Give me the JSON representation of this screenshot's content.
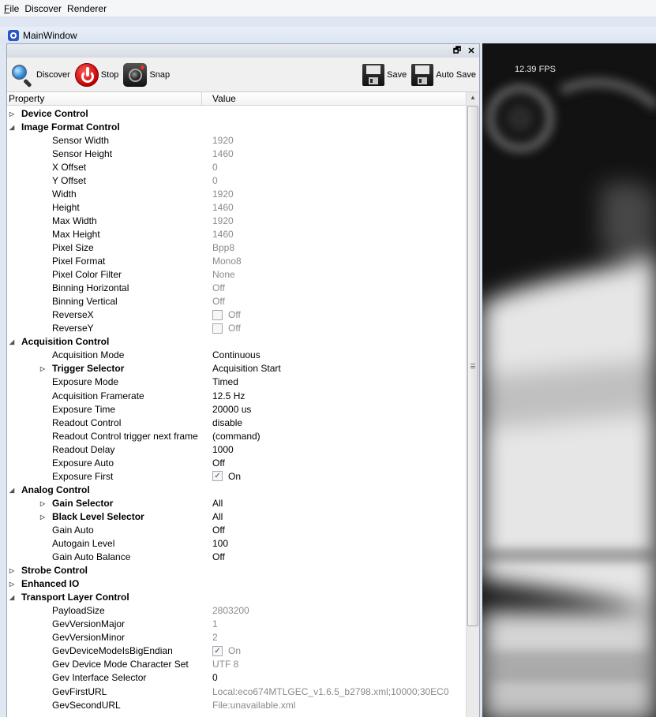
{
  "menu": {
    "items": [
      {
        "label": "File",
        "accel": "F",
        "rest": "ile"
      },
      {
        "label": "Discover",
        "accel": "",
        "rest": "Discover"
      },
      {
        "label": "Renderer",
        "accel": "",
        "rest": "Renderer"
      }
    ]
  },
  "window": {
    "title": "MainWindow"
  },
  "dock": {
    "float_glyph": "🗗",
    "close_glyph": "✕"
  },
  "toolbar": {
    "discover": "Discover",
    "stop": "Stop",
    "snap": "Snap",
    "save": "Save",
    "auto_save": "Auto Save"
  },
  "grid": {
    "header_property": "Property",
    "header_value": "Value",
    "rows": [
      {
        "name": "Device Control",
        "value": "",
        "level": 0,
        "expander": "collapsed",
        "ro": false
      },
      {
        "name": "Image Format Control",
        "value": "",
        "level": 0,
        "expander": "expanded",
        "ro": false
      },
      {
        "name": "Sensor Width",
        "value": "1920",
        "level": 1,
        "ro": true
      },
      {
        "name": "Sensor Height",
        "value": "1460",
        "level": 1,
        "ro": true
      },
      {
        "name": "X Offset",
        "value": "0",
        "level": 1,
        "ro": true
      },
      {
        "name": "Y Offset",
        "value": "0",
        "level": 1,
        "ro": true
      },
      {
        "name": "Width",
        "value": "1920",
        "level": 1,
        "ro": true
      },
      {
        "name": "Height",
        "value": "1460",
        "level": 1,
        "ro": true
      },
      {
        "name": "Max Width",
        "value": "1920",
        "level": 1,
        "ro": true
      },
      {
        "name": "Max Height",
        "value": "1460",
        "level": 1,
        "ro": true
      },
      {
        "name": "Pixel Size",
        "value": "Bpp8",
        "level": 1,
        "ro": true
      },
      {
        "name": "Pixel Format",
        "value": "Mono8",
        "level": 1,
        "ro": true
      },
      {
        "name": "Pixel Color Filter",
        "value": "None",
        "level": 1,
        "ro": true
      },
      {
        "name": "Binning Horizontal",
        "value": "Off",
        "level": 1,
        "ro": true
      },
      {
        "name": "Binning Vertical",
        "value": "Off",
        "level": 1,
        "ro": true
      },
      {
        "name": "ReverseX",
        "value": "Off",
        "level": 1,
        "ro": true,
        "checkbox": "unchecked"
      },
      {
        "name": "ReverseY",
        "value": "Off",
        "level": 1,
        "ro": true,
        "checkbox": "unchecked"
      },
      {
        "name": "Acquisition Control",
        "value": "",
        "level": 0,
        "expander": "expanded",
        "ro": false
      },
      {
        "name": "Acquisition Mode",
        "value": "Continuous",
        "level": 1,
        "ro": false
      },
      {
        "name": "Trigger Selector",
        "value": "Acquisition Start",
        "level": 1,
        "ro": false,
        "expander": "collapsed",
        "bold": true
      },
      {
        "name": "Exposure Mode",
        "value": "Timed",
        "level": 1,
        "ro": false
      },
      {
        "name": "Acquisition Framerate",
        "value": "12.5 Hz",
        "level": 1,
        "ro": false
      },
      {
        "name": "Exposure Time",
        "value": "20000 us",
        "level": 1,
        "ro": false
      },
      {
        "name": "Readout Control",
        "value": "disable",
        "level": 1,
        "ro": false
      },
      {
        "name": "Readout Control trigger next frame",
        "value": "(command)",
        "level": 1,
        "ro": false
      },
      {
        "name": "Readout Delay",
        "value": "1000",
        "level": 1,
        "ro": false
      },
      {
        "name": "Exposure Auto",
        "value": "Off",
        "level": 1,
        "ro": false
      },
      {
        "name": "Exposure First",
        "value": "On",
        "level": 1,
        "ro": false,
        "checkbox": "checked"
      },
      {
        "name": "Analog Control",
        "value": "",
        "level": 0,
        "expander": "expanded",
        "ro": false
      },
      {
        "name": "Gain Selector",
        "value": "All",
        "level": 1,
        "ro": false,
        "expander": "collapsed",
        "bold": true
      },
      {
        "name": "Black Level Selector",
        "value": "All",
        "level": 1,
        "ro": false,
        "expander": "collapsed",
        "bold": true
      },
      {
        "name": "Gain Auto",
        "value": "Off",
        "level": 1,
        "ro": false
      },
      {
        "name": "Autogain Level",
        "value": "100",
        "level": 1,
        "ro": false
      },
      {
        "name": "Gain Auto Balance",
        "value": "Off",
        "level": 1,
        "ro": false
      },
      {
        "name": "Strobe Control",
        "value": "",
        "level": 0,
        "expander": "collapsed",
        "ro": false
      },
      {
        "name": "Enhanced IO",
        "value": "",
        "level": 0,
        "expander": "collapsed",
        "ro": false
      },
      {
        "name": "Transport Layer Control",
        "value": "",
        "level": 0,
        "expander": "expanded",
        "ro": false
      },
      {
        "name": "PayloadSize",
        "value": "2803200",
        "level": 1,
        "ro": true
      },
      {
        "name": "GevVersionMajor",
        "value": "1",
        "level": 1,
        "ro": true
      },
      {
        "name": "GevVersionMinor",
        "value": "2",
        "level": 1,
        "ro": true
      },
      {
        "name": "GevDeviceModeIsBigEndian",
        "value": "On",
        "level": 1,
        "ro": true,
        "checkbox": "checked"
      },
      {
        "name": "Gev Device Mode Character Set",
        "value": "UTF 8",
        "level": 1,
        "ro": true
      },
      {
        "name": "Gev Interface Selector",
        "value": "0",
        "level": 1,
        "ro": false
      },
      {
        "name": "GevFirstURL",
        "value": "Local:eco674MTLGEC_v1.6.5_b2798.xml;10000;30EC0",
        "level": 1,
        "ro": true
      },
      {
        "name": "GevSecondURL",
        "value": "File:unavailable.xml",
        "level": 1,
        "ro": true
      }
    ]
  },
  "video": {
    "fps": "12.39 FPS"
  },
  "colors": {
    "accent": "#2a56c6",
    "readonly_text": "#8a8a8a"
  }
}
